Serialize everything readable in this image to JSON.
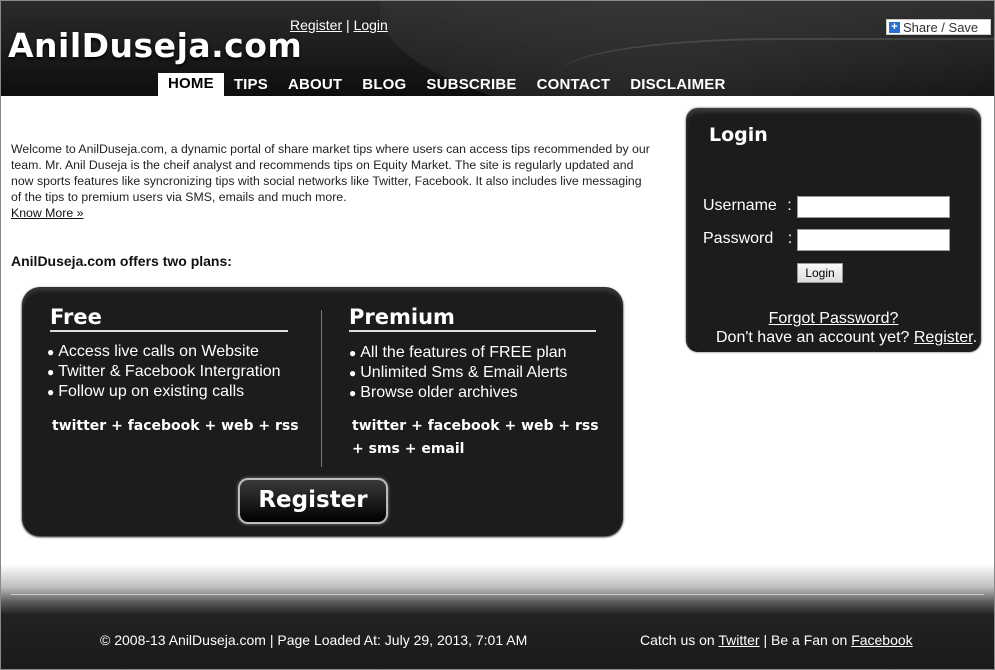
{
  "header": {
    "logo_text": "AnilDuseja.com",
    "register_link": "Register",
    "separator": "|",
    "login_link": "Login",
    "share_label": "Share / Save",
    "share_icon": "plus-icon"
  },
  "nav": {
    "items": [
      {
        "label": "HOME",
        "active": true
      },
      {
        "label": "TIPS"
      },
      {
        "label": "ABOUT"
      },
      {
        "label": "BLOG"
      },
      {
        "label": "SUBSCRIBE"
      },
      {
        "label": "CONTACT"
      },
      {
        "label": "DISCLAIMER"
      }
    ]
  },
  "main": {
    "intro_text": "Welcome to AnilDuseja.com, a dynamic portal of share market tips where users can access tips recommended by our team. Mr. Anil Duseja is the cheif analyst and recommends tips on Equity Market. The site is regularly updated and now sports features like syncronizing tips with social networks like Twitter, Facebook. It also includes live messaging of the tips to premium users via SMS, emails and much more.",
    "know_more_link": "Know More »",
    "plans_heading": "AnilDuseja.com offers two plans:",
    "plans": {
      "free": {
        "title": "Free",
        "features": [
          "Access live calls on Website",
          "Twitter & Facebook Intergration",
          "Follow up on existing calls"
        ],
        "channels_line1": "twitter + facebook + web + rss",
        "channels_line2": ""
      },
      "premium": {
        "title": "Premium",
        "features": [
          "All the features of FREE plan",
          "Unlimited Sms & Email Alerts",
          "Browse older archives"
        ],
        "channels_line1": "twitter + facebook + web + rss",
        "channels_line2": "+ sms + email"
      },
      "register_button": "Register"
    }
  },
  "login": {
    "title": "Login",
    "username_label": "Username",
    "password_label": "Password",
    "colon": ":",
    "username_value": "",
    "password_value": "",
    "submit_label": "Login",
    "forgot_link": "Forgot Password?",
    "signup_prefix": "Don't have an account yet? ",
    "signup_link": "Register",
    "signup_suffix": "."
  },
  "footer": {
    "copyright": "© 2008-13 AnilDuseja.com | Page Loaded At: July 29, 2013, 7:01 AM",
    "catch_us_prefix": "Catch us on ",
    "twitter_link": "Twitter",
    "fan_mid": " | Be a Fan on ",
    "facebook_link": "Facebook"
  }
}
